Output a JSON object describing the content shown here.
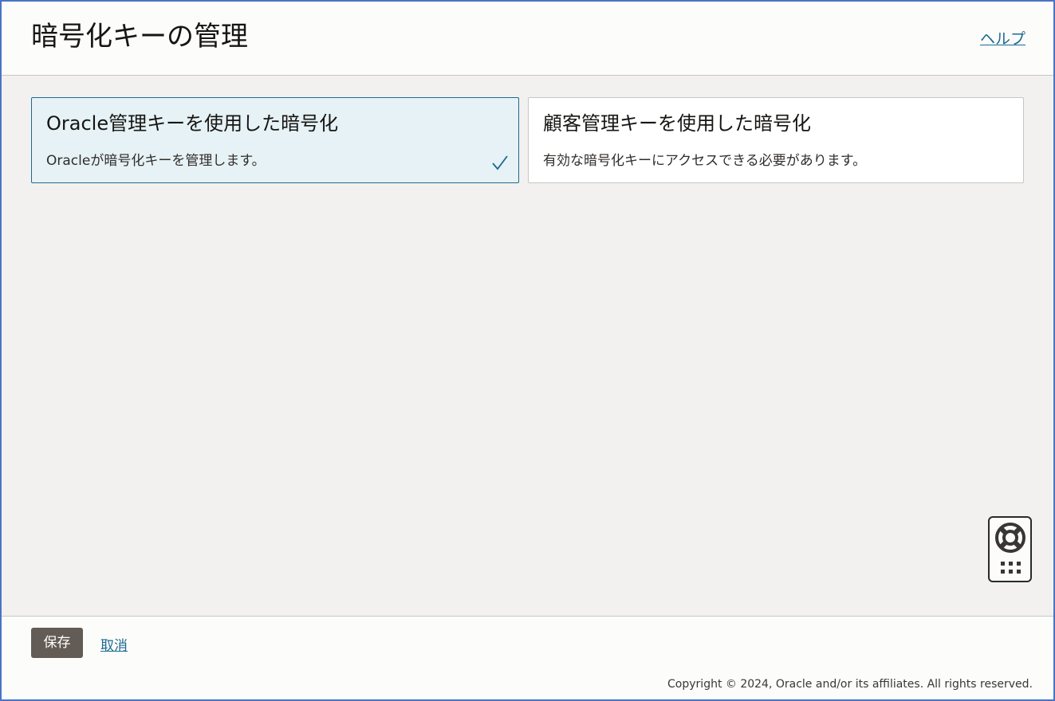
{
  "header": {
    "title": "暗号化キーの管理",
    "help_label": "ヘルプ"
  },
  "options": [
    {
      "title": "Oracle管理キーを使用した暗号化",
      "description": "Oracleが暗号化キーを管理します。",
      "selected": true
    },
    {
      "title": "顧客管理キーを使用した暗号化",
      "description": "有効な暗号化キーにアクセスできる必要があります。",
      "selected": false
    }
  ],
  "help_widget": {
    "icons": [
      "lifebuoy-icon",
      "grid-icon"
    ]
  },
  "footer": {
    "save_label": "保存",
    "cancel_label": "取消"
  },
  "copyright": "Copyright © 2024, Oracle and/or its affiliates. All rights reserved.",
  "colors": {
    "accent": "#1d6a8f",
    "selected_bg": "#e6f2f5",
    "button_bg": "#635b55",
    "page_bg": "#f2f1ef"
  }
}
